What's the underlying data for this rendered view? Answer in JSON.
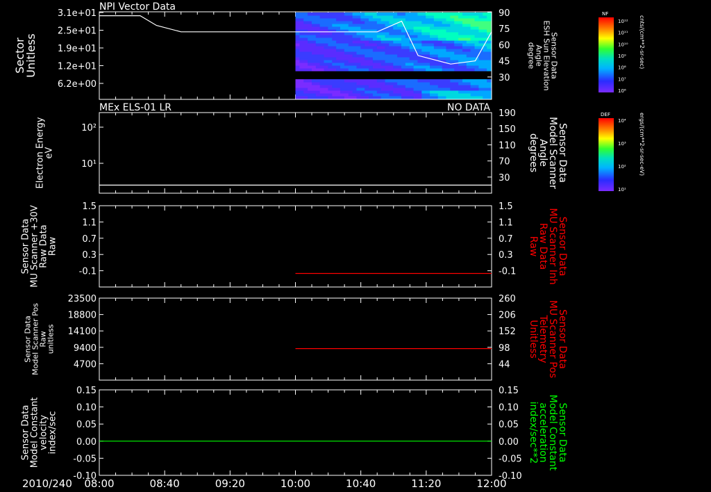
{
  "time_axis": {
    "date_label": "2010/240",
    "ticks": [
      "08:00",
      "08:40",
      "09:20",
      "10:00",
      "10:40",
      "11:20",
      "12:00"
    ]
  },
  "panels": [
    {
      "id": "npi",
      "title_left": "NPI Vector Data",
      "title_right": "",
      "left_label": [
        "Sector",
        "Unitless"
      ],
      "left_ticks": [
        "3.1e+01",
        "2.5e+01",
        "1.9e+01",
        "1.2e+01",
        "6.2e+00"
      ],
      "right_label": [
        "Sensor Data",
        "ESH Sun Elevation",
        "Angle",
        "degree"
      ],
      "right_ticks": [
        "90",
        "75",
        "60",
        "45",
        "30"
      ],
      "colorbar": {
        "title": "NF",
        "ticks": [
          "10¹²",
          "10¹¹",
          "10¹⁰",
          "10⁹",
          "10⁸",
          "10⁷",
          "10⁶"
        ],
        "unit": "cnts/(cm**2-sr-sec)"
      }
    },
    {
      "id": "els",
      "title_left": "MEx ELS-01 LR",
      "title_right": "NO DATA",
      "left_label": [
        "Electron Energy",
        "eV"
      ],
      "left_ticks": [
        "10²",
        "10¹"
      ],
      "right_label": [
        "Sensor Data",
        "Model Scanner",
        "Angle",
        "degrees"
      ],
      "right_ticks": [
        "190",
        "150",
        "110",
        "70",
        "30"
      ],
      "colorbar": {
        "title": "DEF",
        "ticks": [
          "10⁴",
          "10³",
          "10²",
          "10¹"
        ],
        "unit": "ergs/(cm**2-sr-sec-eV)"
      }
    },
    {
      "id": "mu_raw",
      "title_left": "",
      "title_right": "",
      "left_label": [
        "Sensor Data",
        "MU Scanner +30V",
        "Raw Data",
        "Raw"
      ],
      "left_ticks": [
        "1.5",
        "1.1",
        "0.7",
        "0.3",
        "-0.1"
      ],
      "right_label": [
        "Sensor Data",
        "MU Scanner Inh",
        "Raw Data",
        "Raw"
      ],
      "right_ticks": [
        "1.5",
        "1.1",
        "0.7",
        "0.3",
        "-0.1"
      ]
    },
    {
      "id": "mu_pos",
      "title_left": "",
      "title_right": "",
      "left_label": [
        "Sensor Data",
        "Model Scanner Pos",
        "Raw",
        "unitless"
      ],
      "left_ticks": [
        "23500",
        "18800",
        "14100",
        "9400",
        "4700"
      ],
      "right_label": [
        "Sensor Data",
        "MU Scanner Pos",
        "Telemetry",
        "Unitless"
      ],
      "right_ticks": [
        "260",
        "206",
        "152",
        "98",
        "44"
      ]
    },
    {
      "id": "model_const",
      "title_left": "",
      "title_right": "",
      "left_label": [
        "Sensor Data",
        "Model Constant",
        "velocity",
        "index/sec"
      ],
      "left_ticks": [
        "0.15",
        "0.10",
        "0.05",
        "0.00",
        "-0.05",
        "-0.10"
      ],
      "right_label": [
        "Sensor Data",
        "Model Constant",
        "acceleration",
        "index/sec**2"
      ],
      "right_ticks": [
        "0.15",
        "0.10",
        "0.05",
        "0.00",
        "-0.05",
        "-0.10"
      ]
    }
  ],
  "colors": {
    "background": "#000000",
    "foreground": "#ffffff",
    "red_series": "#ff0000",
    "green_series": "#00ff00"
  },
  "chart_data": [
    {
      "type": "heatmap",
      "title": "NPI Vector Data",
      "x_range": [
        "08:00",
        "12:00"
      ],
      "ylabel": "Sector Unitless",
      "ylim": [
        0,
        31
      ],
      "data_start": "10:00",
      "overlay_series": {
        "name": "ESH Sun Elevation Angle",
        "unit": "degree",
        "x": [
          "08:00",
          "08:25",
          "08:35",
          "08:50",
          "10:00",
          "10:50",
          "11:05",
          "11:15",
          "11:35",
          "11:50",
          "12:00"
        ],
        "y": [
          87,
          87,
          78,
          72,
          72,
          72,
          82,
          50,
          42,
          45,
          72
        ]
      }
    },
    {
      "type": "line",
      "title": "MEx ELS-01 LR",
      "status": "NO DATA",
      "series": [
        {
          "name": "Model Scanner Angle",
          "x": [
            "08:00",
            "12:00"
          ],
          "y": [
            10,
            10
          ]
        }
      ],
      "ylim": [
        -10,
        190
      ]
    },
    {
      "type": "line",
      "series": [
        {
          "name": "MU Scanner Inh Raw Data",
          "color": "#ff0000",
          "x": [
            "10:00",
            "12:00"
          ],
          "y": [
            0,
            0
          ]
        }
      ],
      "ylim": [
        -0.3,
        1.5
      ]
    },
    {
      "type": "line",
      "series": [
        {
          "name": "MU Scanner Pos Telemetry",
          "color": "#ff0000",
          "x": [
            "10:00",
            "12:00"
          ],
          "y": [
            100,
            100
          ]
        }
      ],
      "ylim": [
        0,
        260
      ]
    },
    {
      "type": "line",
      "series": [
        {
          "name": "Model Constant velocity",
          "color": "#00ff00",
          "x": [
            "08:00",
            "12:00"
          ],
          "y": [
            0,
            0
          ]
        }
      ],
      "ylim": [
        -0.1,
        0.15
      ]
    }
  ]
}
